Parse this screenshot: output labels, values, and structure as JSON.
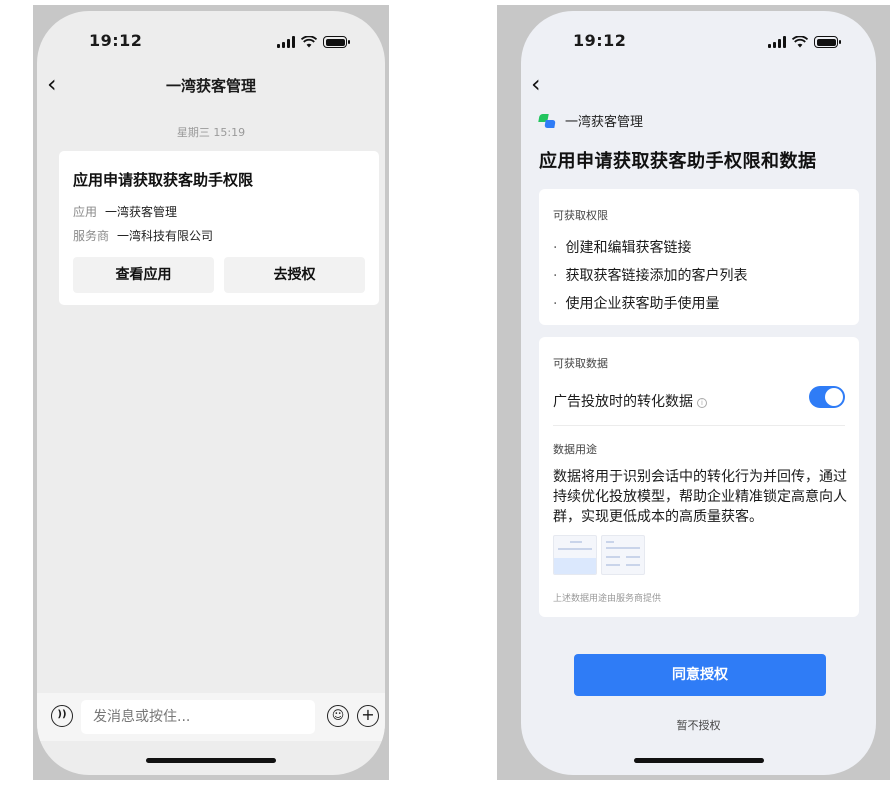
{
  "left": {
    "status": {
      "time": "19:12"
    },
    "nav": {
      "title": "一湾获客管理"
    },
    "timestamp": "星期三 15:19",
    "message": {
      "title": "应用申请获取获客助手权限",
      "app_key": "应用",
      "app_value": "一湾获客管理",
      "provider_key": "服务商",
      "provider_value": "一湾科技有限公司",
      "view_button": "查看应用",
      "authorize_button": "去授权"
    },
    "input": {
      "placeholder": "发消息或按住..."
    }
  },
  "right": {
    "status": {
      "time": "19:12"
    },
    "app_name": "一湾获客管理",
    "title": "应用申请获取获客助手权限和数据",
    "permissions": {
      "heading": "可获取权限",
      "items": [
        "创建和编辑获客链接",
        "获取获客链接添加的客户列表",
        "使用企业获客助手使用量"
      ]
    },
    "data": {
      "heading": "可获取数据",
      "item_label": "广告投放时的转化数据",
      "toggle_on": true,
      "usage_heading": "数据用途",
      "usage_text": "数据将用于识别会话中的转化行为并回传，通过持续优化投放模型，帮助企业精准锁定高意向人群，实现更低成本的高质量获客。",
      "note": "上述数据用途由服务商提供"
    },
    "agree_button": "同意授权",
    "decline_link": "暂不授权"
  },
  "colors": {
    "accent": "#2f7cf6",
    "logo_green": "#22c55e"
  }
}
